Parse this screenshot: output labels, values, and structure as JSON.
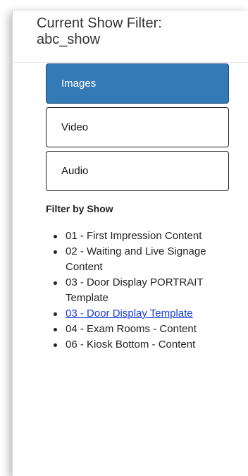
{
  "header": {
    "line1": "Current Show Filter:",
    "line2": "abc_show"
  },
  "media_tabs": [
    {
      "label": "Images",
      "active": true
    },
    {
      "label": "Video",
      "active": false
    },
    {
      "label": "Audio",
      "active": false
    }
  ],
  "filter_heading": "Filter by Show",
  "shows": [
    {
      "label": "01 - First Impression Content",
      "link": false
    },
    {
      "label": "02 - Waiting and Live Signage Content",
      "link": false
    },
    {
      "label": "03 - Door Display PORTRAIT Template",
      "link": false
    },
    {
      "label": "03 - Door Display Template",
      "link": true
    },
    {
      "label": "04 - Exam Rooms - Content",
      "link": false
    },
    {
      "label": "06 - Kiosk Bottom - Content",
      "link": false
    }
  ],
  "colors": {
    "active_tab": "#337ab7",
    "link": "#1a3fd6"
  }
}
